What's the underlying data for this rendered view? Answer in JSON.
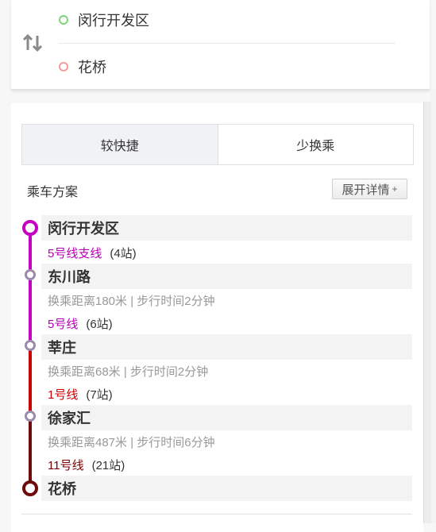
{
  "route": {
    "origin": "闵行开发区",
    "destination": "花桥"
  },
  "tabs": [
    {
      "label": "较快捷",
      "active": true
    },
    {
      "label": "少换乘",
      "active": false
    }
  ],
  "plan": {
    "title": "乘车方案",
    "expand_label": "展开详情",
    "expand_plus": "+"
  },
  "itinerary": {
    "stations": [
      "闵行开发区",
      "东川路",
      "莘庄",
      "徐家汇",
      "花桥"
    ],
    "rides": [
      {
        "line": "5号线支线",
        "stops": "(4站)",
        "color": "#b300b3"
      },
      {
        "line": "5号线",
        "stops": "(6站)",
        "color": "#b300b3"
      },
      {
        "line": "1号线",
        "stops": "(7站)",
        "color": "#cc0000"
      },
      {
        "line": "11号线",
        "stops": "(21站)",
        "color": "#7a0000"
      }
    ],
    "transfers": [
      "换乘距离180米 | 步行时间2分钟",
      "换乘距离68米 | 步行时间2分钟",
      "换乘距离487米 | 步行时间6分钟"
    ]
  },
  "colors": {
    "line5": "#c400c4",
    "line1": "#cc0000",
    "line11": "#6e0a0a",
    "transfer_node": "#9b8aa8"
  }
}
